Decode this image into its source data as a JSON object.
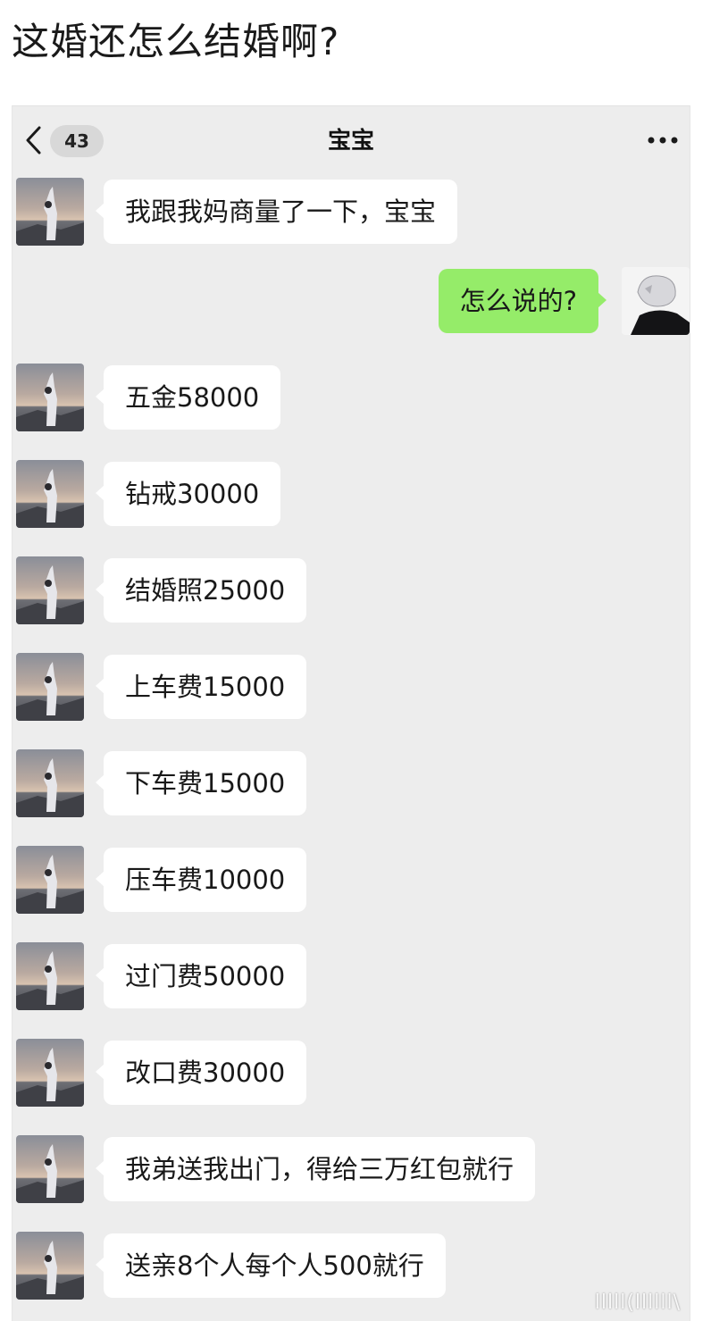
{
  "post": {
    "title": "这婚还怎么结婚啊?"
  },
  "chat": {
    "unread_count": "43",
    "contact_name": "宝宝",
    "icons": {
      "back": "chevron-left-icon",
      "more": "more-horizontal-icon"
    },
    "colors": {
      "background": "#ededed",
      "incoming_bubble": "#ffffff",
      "outgoing_bubble": "#95ec69"
    },
    "messages": [
      {
        "side": "left",
        "text": "我跟我妈商量了一下，宝宝"
      },
      {
        "side": "right",
        "text": "怎么说的?"
      },
      {
        "side": "left",
        "text": "五金58000"
      },
      {
        "side": "left",
        "text": "钻戒30000"
      },
      {
        "side": "left",
        "text": "结婚照25000"
      },
      {
        "side": "left",
        "text": "上车费15000"
      },
      {
        "side": "left",
        "text": "下车费15000"
      },
      {
        "side": "left",
        "text": "压车费10000"
      },
      {
        "side": "left",
        "text": "过门费50000"
      },
      {
        "side": "left",
        "text": "改口费30000"
      },
      {
        "side": "left",
        "text": "我弟送我出门，得给三万红包就行"
      },
      {
        "side": "left",
        "text": "送亲8个人每个人500就行"
      }
    ]
  },
  "watermark": "lllll(llllll\\"
}
